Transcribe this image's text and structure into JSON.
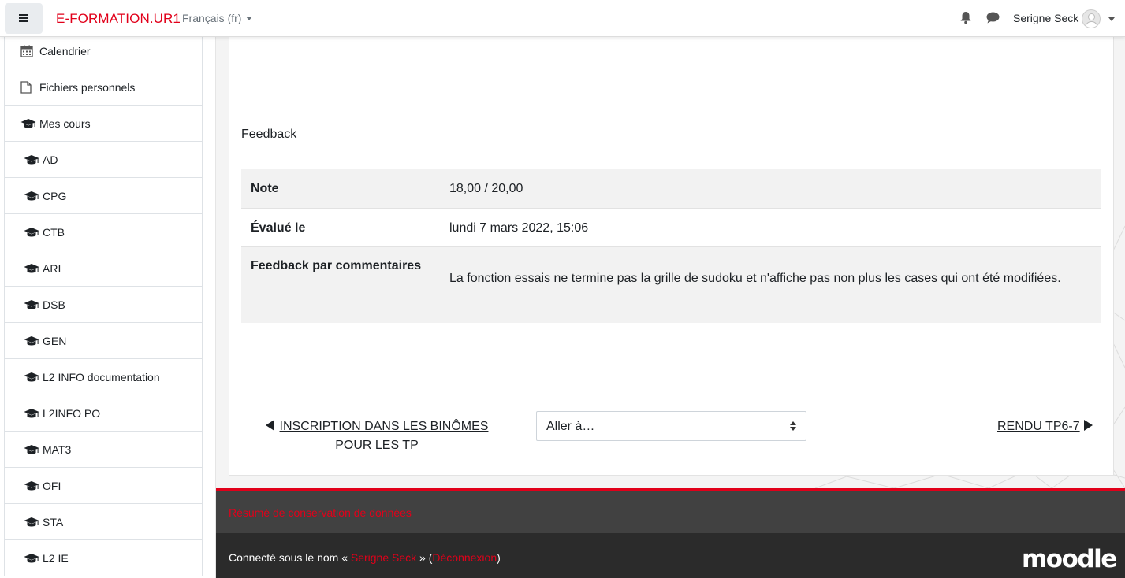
{
  "navbar": {
    "brand": "E-FORMATION.UR1",
    "language": "Français (fr)",
    "user_name": "Serigne Seck"
  },
  "sidebar": {
    "items": [
      {
        "label": "Calendrier",
        "icon": "calendar-icon"
      },
      {
        "label": "Fichiers personnels",
        "icon": "file-icon"
      },
      {
        "label": "Mes cours",
        "icon": "graduation-cap-icon"
      },
      {
        "label": "AD",
        "icon": "graduation-cap-icon"
      },
      {
        "label": "CPG",
        "icon": "graduation-cap-icon"
      },
      {
        "label": "CTB",
        "icon": "graduation-cap-icon"
      },
      {
        "label": "ARI",
        "icon": "graduation-cap-icon"
      },
      {
        "label": "DSB",
        "icon": "graduation-cap-icon"
      },
      {
        "label": "GEN",
        "icon": "graduation-cap-icon"
      },
      {
        "label": "L2 INFO documentation",
        "icon": "graduation-cap-icon"
      },
      {
        "label": "L2INFO PO",
        "icon": "graduation-cap-icon"
      },
      {
        "label": "MAT3",
        "icon": "graduation-cap-icon"
      },
      {
        "label": "OFI",
        "icon": "graduation-cap-icon"
      },
      {
        "label": "STA",
        "icon": "graduation-cap-icon"
      },
      {
        "label": "L2 IE",
        "icon": "graduation-cap-icon"
      }
    ]
  },
  "feedback": {
    "title": "Feedback",
    "rows": [
      {
        "label": "Note",
        "value": "18,00 / 20,00"
      },
      {
        "label": "Évalué le",
        "value": "lundi 7 mars 2022, 15:06"
      },
      {
        "label": "Feedback par commentaires",
        "value": "La fonction essais ne termine pas la grille de sudoku et n'affiche pas non plus les cases qui ont été modifiées."
      }
    ]
  },
  "activity_nav": {
    "prev_label": "INSCRIPTION DANS LES BINÔMES POUR LES TP",
    "jump_placeholder": "Aller à…",
    "next_label": "RENDU TP6-7"
  },
  "footer": {
    "policy_link": "Résumé de conservation de données",
    "logged_in_prefix": "Connecté sous le nom « ",
    "logged_in_user": "Serigne Seck",
    "logged_in_mid": " » (",
    "logout_label": "Déconnexion",
    "logged_in_suffix": ")",
    "logo_text": "moodle"
  },
  "colors": {
    "brand": "#e1001a",
    "footer_top": "#414141",
    "footer_bottom": "#2b2b2b"
  }
}
